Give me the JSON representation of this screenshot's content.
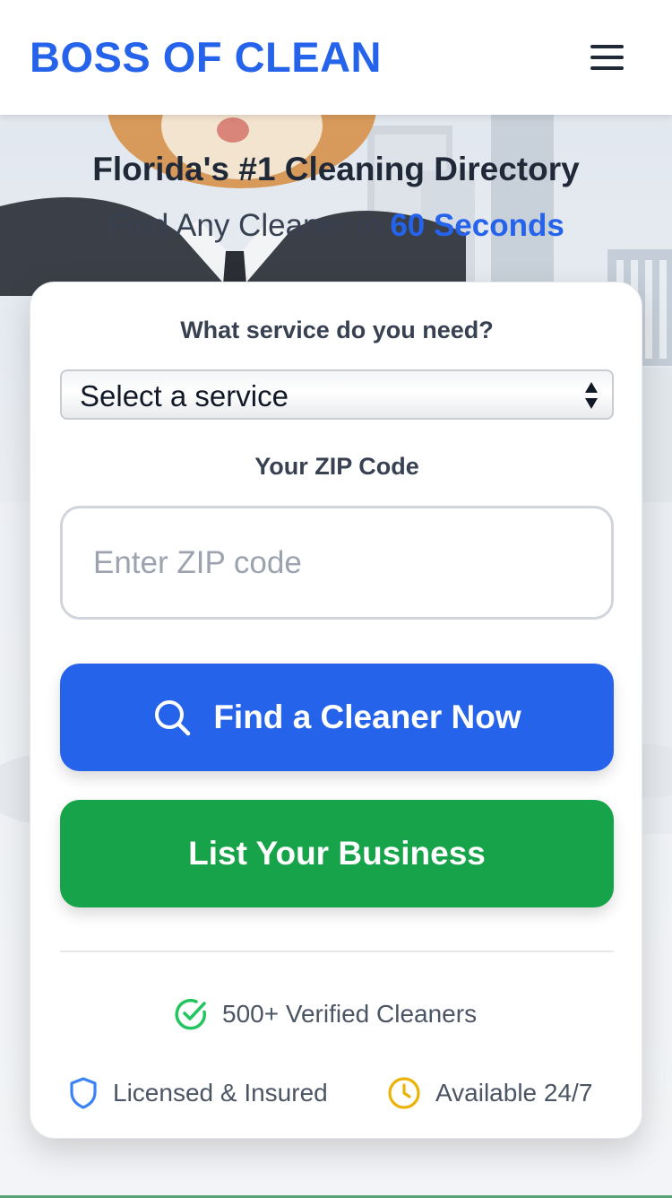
{
  "header": {
    "logo": "BOSS OF CLEAN",
    "menu_icon": "hamburger-menu-icon"
  },
  "hero": {
    "subtitle": "Florida's #1 Cleaning Directory",
    "tagline_prefix": "Find Any Cleaner in ",
    "tagline_highlight": "60 Seconds"
  },
  "form": {
    "service_label": "What service do you need?",
    "service_selected": "Select a service",
    "zip_label": "Your ZIP Code",
    "zip_placeholder": "Enter ZIP code",
    "zip_value": ""
  },
  "buttons": {
    "find_label": "Find a Cleaner Now",
    "find_icon": "search-icon",
    "list_label": "List Your Business"
  },
  "trust": {
    "verified": "500+ Verified Cleaners",
    "licensed": "Licensed & Insured",
    "available": "Available 24/7"
  },
  "colors": {
    "brand_blue": "#2563eb",
    "cta_green": "#16a34a",
    "check_green": "#22c55e",
    "shield_blue": "#3b82f6",
    "clock_amber": "#eab308"
  }
}
